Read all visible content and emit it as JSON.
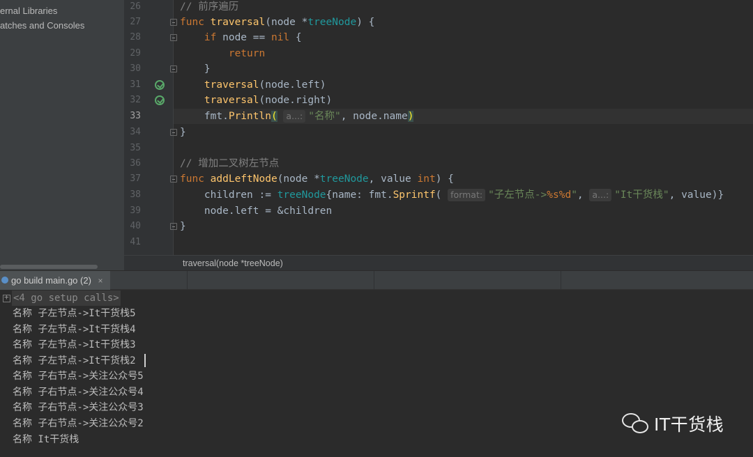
{
  "sidebar": {
    "items": [
      {
        "label": "ernal Libraries"
      },
      {
        "label": "atches and Consoles"
      }
    ]
  },
  "editor": {
    "lines": [
      {
        "no": "26"
      },
      {
        "no": "27"
      },
      {
        "no": "28"
      },
      {
        "no": "29"
      },
      {
        "no": "30"
      },
      {
        "no": "31"
      },
      {
        "no": "32"
      },
      {
        "no": "33"
      },
      {
        "no": "34"
      },
      {
        "no": "35"
      },
      {
        "no": "36"
      },
      {
        "no": "37"
      },
      {
        "no": "38"
      },
      {
        "no": "39"
      },
      {
        "no": "40"
      },
      {
        "no": "41"
      }
    ],
    "tokens": {
      "l26_comment": "// 前序遍历",
      "kw_func": "func",
      "kw_if": "if",
      "kw_return": "return",
      "fn_traversal": "traversal",
      "param_node": "(node *",
      "type_treeNode": "treeNode",
      "paren_brace": ") {",
      "if_cond": " node == ",
      "kw_nil": "nil",
      "open_brace": " {",
      "close_brace": "}",
      "call_left": "(node.left)",
      "call_right": "(node.right)",
      "fmt_println": "fmt.",
      "fn_println": "Println",
      "open_paren": "(",
      "hint_a": "a...:",
      "str_name": "\"名称\"",
      "println_rest": ", node.name",
      "close_paren": ")",
      "l36_comment": "// 增加二叉树左节点",
      "fn_addLeftNode": "addLeftNode",
      "param_value": ", value ",
      "type_int": "int",
      "children_assign": "children := ",
      "lit_name": "{name: ",
      "fmt_sprintf": "fmt.",
      "fn_sprintf": "Sprintf",
      "hint_format": "format:",
      "str_format_a": "\"子左节点->",
      "str_format_b": "%s%d",
      "str_format_c": "\"",
      "comma": ", ",
      "str_it": "\"It干货栈\"",
      "sprintf_rest": ", value)}",
      "left_assign": "node.left = &children"
    }
  },
  "breadcrumb": {
    "text": "traversal(node *treeNode)"
  },
  "run_panel": {
    "tab_label": "go build main.go (2)",
    "close_glyph": "×"
  },
  "console": {
    "folded_label": "<4 go setup calls>",
    "lines": [
      "名称 子左节点->It干货栈5",
      "名称 子左节点->It干货栈4",
      "名称 子左节点->It干货栈3",
      "名称 子左节点->It干货栈2",
      "名称 子右节点->关注公众号5",
      "名称 子右节点->关注公众号4",
      "名称 子右节点->关注公众号3",
      "名称 子右节点->关注公众号2",
      "名称 It干货栈"
    ]
  },
  "watermark": {
    "text": "IT干货栈",
    "icon": "wechat-icon"
  },
  "colors": {
    "keyword": "#cc7832",
    "function": "#ffc66d",
    "type": "#20999d",
    "string": "#6a8759",
    "comment": "#808080",
    "field": "#9876aa",
    "plain": "#a9b7c6"
  }
}
